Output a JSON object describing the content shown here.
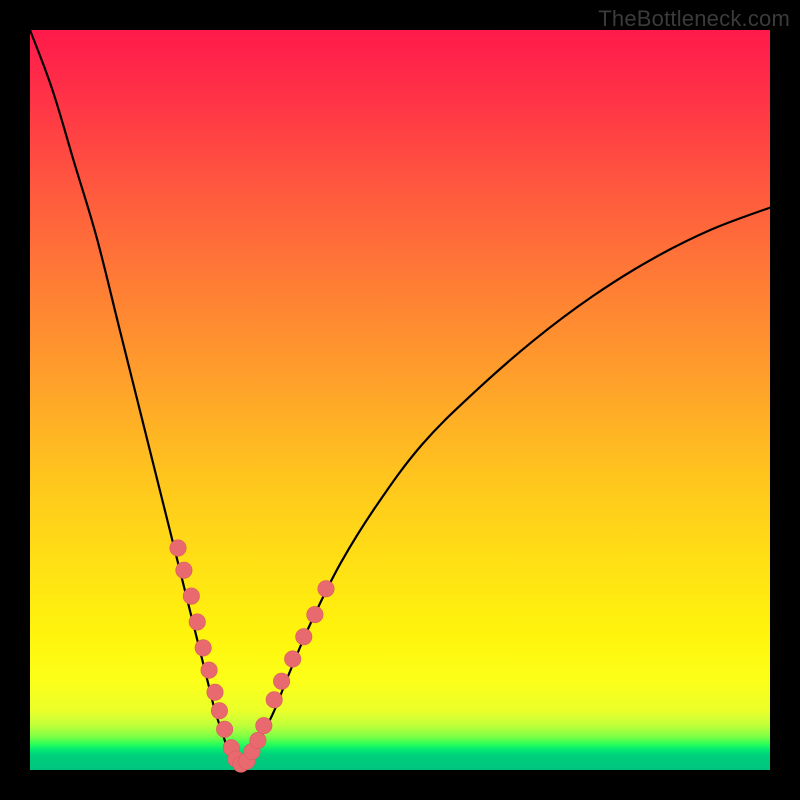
{
  "watermark": "TheBottleneck.com",
  "colors": {
    "page_bg": "#000000",
    "curve_stroke": "#000000",
    "dot_fill": "#e86a6f",
    "dot_stroke": "#d95a60",
    "gradient_top": "#ff1a4b",
    "gradient_bottom": "#00c47e"
  },
  "chart_data": {
    "type": "line",
    "title": "",
    "xlabel": "",
    "ylabel": "",
    "xlim": [
      0,
      100
    ],
    "ylim": [
      0,
      100
    ],
    "grid": false,
    "legend": false,
    "description": "V-shaped bottleneck curve on a red-to-green vertical gradient. The curve descends steeply from the top-left, reaches a minimum near x≈28 at the bottom (y≈0), then rises more gradually toward the upper right, ending near y≈76 at x=100.",
    "series": [
      {
        "name": "bottleneck_curve",
        "x": [
          0,
          3,
          6,
          9,
          12,
          15,
          18,
          20,
          22,
          24,
          25,
          26,
          27,
          28,
          29,
          30,
          31,
          33,
          35,
          38,
          42,
          47,
          53,
          60,
          68,
          76,
          84,
          92,
          100
        ],
        "y": [
          100,
          92,
          82,
          72,
          60,
          48,
          36,
          28,
          20,
          12,
          8,
          5,
          2,
          0.5,
          0.5,
          2,
          4,
          8,
          13,
          20,
          28,
          36,
          44,
          51,
          58,
          64,
          69,
          73,
          76
        ]
      }
    ],
    "points": {
      "name": "highlighted_points",
      "comment": "Salmon dots clustered along the lower portion of both arms of the V.",
      "x": [
        20.0,
        20.8,
        21.8,
        22.6,
        23.4,
        24.2,
        25.0,
        25.6,
        26.3,
        27.2,
        27.8,
        28.5,
        29.3,
        30.0,
        30.8,
        31.6,
        33.0,
        34.0,
        35.5,
        37.0,
        38.5,
        40.0
      ],
      "y": [
        30.0,
        27.0,
        23.5,
        20.0,
        16.5,
        13.5,
        10.5,
        8.0,
        5.5,
        3.0,
        1.5,
        0.8,
        1.2,
        2.5,
        4.0,
        6.0,
        9.5,
        12.0,
        15.0,
        18.0,
        21.0,
        24.5
      ]
    }
  }
}
